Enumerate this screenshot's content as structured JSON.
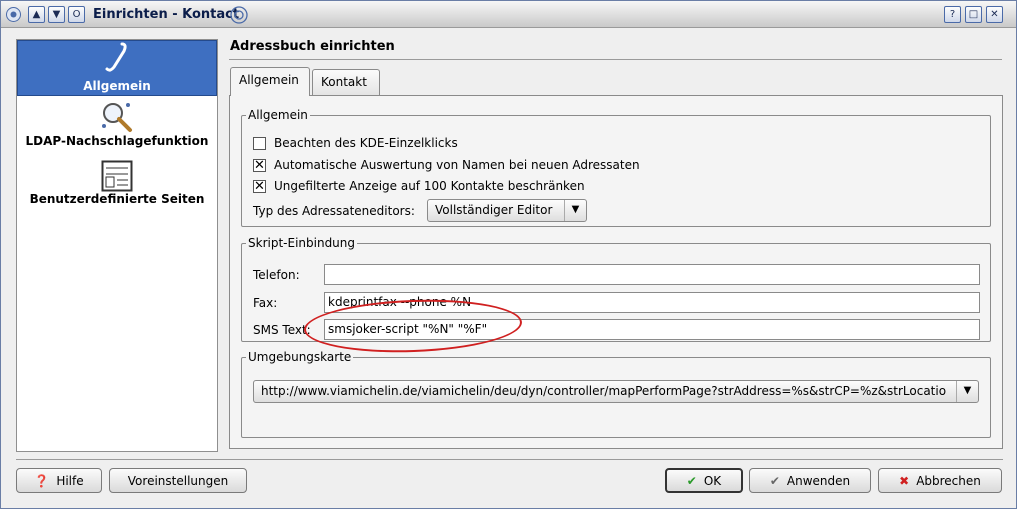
{
  "window": {
    "title": "Einrichten - Kontact",
    "help_btn": "?",
    "max_btn": "□",
    "close_btn": "✕"
  },
  "sidebar": {
    "items": [
      {
        "label": "Allgemein"
      },
      {
        "label": "LDAP-Nachschlagefunktion"
      },
      {
        "label": "Benutzerdefinierte Seiten"
      }
    ]
  },
  "header": {
    "title": "Adressbuch einrichten"
  },
  "tabs": [
    {
      "label": "Allgemein"
    },
    {
      "label": "Kontakt"
    }
  ],
  "general": {
    "legend": "Allgemein",
    "checkboxes": [
      {
        "label": "Beachten des KDE-Einzelklicks",
        "checked": false
      },
      {
        "label": "Automatische Auswertung von Namen bei neuen Adressaten",
        "checked": true
      },
      {
        "label": "Ungefilterte Anzeige auf 100 Kontakte beschränken",
        "checked": true
      }
    ],
    "editor_label": "Typ des Adressateneditors:",
    "editor_value": "Vollständiger Editor"
  },
  "script": {
    "legend": "Skript-Einbindung",
    "phone_label": "Telefon:",
    "phone_value": "",
    "fax_label": "Fax:",
    "fax_value": "kdeprintfax --phone %N",
    "sms_label": "SMS Text:",
    "sms_value": "smsjoker-script \"%N\" \"%F\""
  },
  "map": {
    "legend": "Umgebungskarte",
    "url": "http://www.viamichelin.de/viamichelin/deu/dyn/controller/mapPerformPage?strAddress=%s&strCP=%z&strLocatio"
  },
  "buttons": {
    "help": "Hilfe",
    "defaults": "Voreinstellungen",
    "ok": "OK",
    "apply": "Anwenden",
    "cancel": "Abbrechen"
  },
  "colors": {
    "selection": "#3e6fc1",
    "annotation": "#d02020",
    "ok_check": "#2a9a2a",
    "cancel_x": "#d02020"
  }
}
